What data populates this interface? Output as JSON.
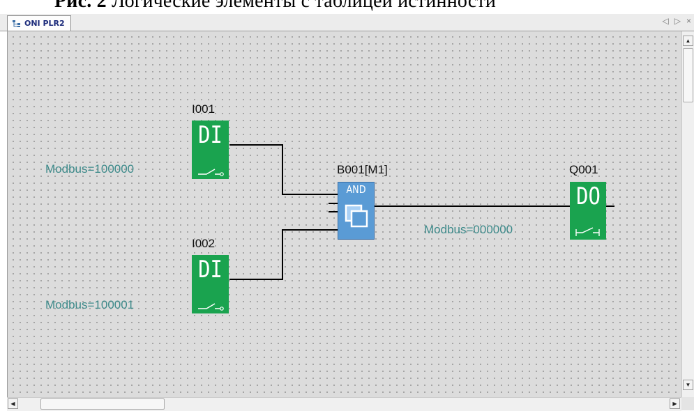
{
  "caption": {
    "prefix": "Рис. 2",
    "text": "Логические элементы с таблицей истинности"
  },
  "tab": {
    "title": "ONI PLR2"
  },
  "nav": {
    "prev": "◁",
    "next": "▷",
    "close": "×"
  },
  "blocks": {
    "i001": {
      "name": "I001",
      "symbol": "DI",
      "modbus": "Modbus=100000"
    },
    "i002": {
      "name": "I002",
      "symbol": "DI",
      "modbus": "Modbus=100001"
    },
    "b001": {
      "name": "B001[M1]",
      "symbol": "AND"
    },
    "q001": {
      "name": "Q001",
      "symbol": "DO",
      "modbus": "Modbus=000000"
    }
  },
  "scrollbars": {
    "up": "▲",
    "down": "▼",
    "left": "◀",
    "right": "▶"
  },
  "colors": {
    "io_block": "#1aa34f",
    "and_block": "#5a9bd5",
    "modbus_text": "#3d8a8a",
    "canvas": "#dcdcdc"
  }
}
